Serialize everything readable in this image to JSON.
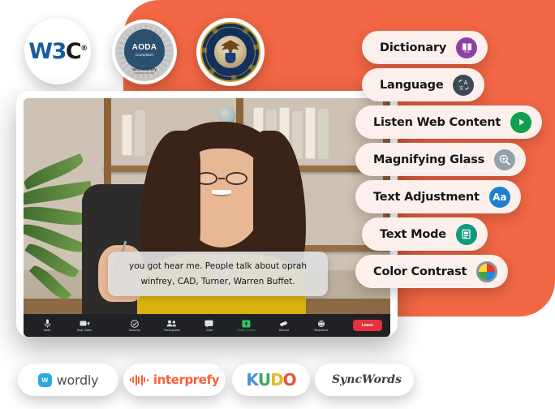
{
  "theme": {
    "accent_orange": "#F26744",
    "pill_bg": "#FBF0EC",
    "zoom_bar_bg": "#1F2124",
    "leave_red": "#E8303F"
  },
  "badges": [
    {
      "name": "w3c",
      "text_primary": "W3",
      "text_secondary": "C",
      "mark": "®"
    },
    {
      "name": "aoda",
      "ring_text": "ACCESSIBILITY FOR ONTARIANS WITH DISABILITIES ACT",
      "title": "AODA",
      "subtitle": "Compliant",
      "footer": "accessibility",
      "footer_sub": "ASSOCIATION"
    },
    {
      "name": "doj",
      "ring_text": "DEPARTMENT OF JUSTICE"
    }
  ],
  "video": {
    "caption_line_1": "you got hear me. People talk about oprah",
    "caption_line_2": "winfrey, CAD, Turner, Warren Buffet."
  },
  "zoom_toolbar": {
    "buttons": [
      {
        "label": "Mute",
        "icon": "microphone-icon",
        "highlight": false
      },
      {
        "label": "Stop Video",
        "icon": "video-camera-icon",
        "highlight": false
      },
      {
        "label": "Security",
        "icon": "shield-icon",
        "highlight": false
      },
      {
        "label": "Participants",
        "icon": "people-icon",
        "highlight": false
      },
      {
        "label": "Chat",
        "icon": "chat-bubble-icon",
        "highlight": false
      },
      {
        "label": "Share Screen",
        "icon": "share-screen-icon",
        "highlight": true
      },
      {
        "label": "Record",
        "icon": "record-icon",
        "highlight": false
      },
      {
        "label": "Reactions",
        "icon": "reactions-icon",
        "highlight": false
      }
    ],
    "leave_label": "Leave"
  },
  "accessibility_menu": [
    {
      "label": "Dictionary",
      "icon": "dictionary-book-icon",
      "icon_glyph": "A-Z",
      "icon_color": "#8E3FA8"
    },
    {
      "label": "Language",
      "icon": "translate-icon",
      "icon_glyph": "A",
      "icon_color": "#3C4A56"
    },
    {
      "label": "Listen Web Content",
      "icon": "play-icon",
      "icon_glyph": "▶",
      "icon_color": "#0F9F4F"
    },
    {
      "label": "Magnifying Glass",
      "icon": "magnifier-icon",
      "icon_glyph": "⊕",
      "icon_color": "#94A0AB"
    },
    {
      "label": "Text Adjustment",
      "icon": "text-size-icon",
      "icon_glyph": "Aa",
      "icon_color": "#1C7FD1"
    },
    {
      "label": "Text Mode",
      "icon": "document-icon",
      "icon_glyph": "▤",
      "icon_color": "#0F9A7E"
    },
    {
      "label": "Color Contrast",
      "icon": "color-wheel-icon",
      "icon_glyph": "",
      "icon_color": "#8B9199"
    }
  ],
  "partner_logos": [
    {
      "name": "wordly",
      "text": "wordly",
      "mark": "w"
    },
    {
      "name": "interprefy",
      "text": "interprefy"
    },
    {
      "name": "kudo",
      "letters": [
        "K",
        "U",
        "D",
        "O"
      ]
    },
    {
      "name": "syncwords",
      "text": "SyncWords"
    }
  ]
}
